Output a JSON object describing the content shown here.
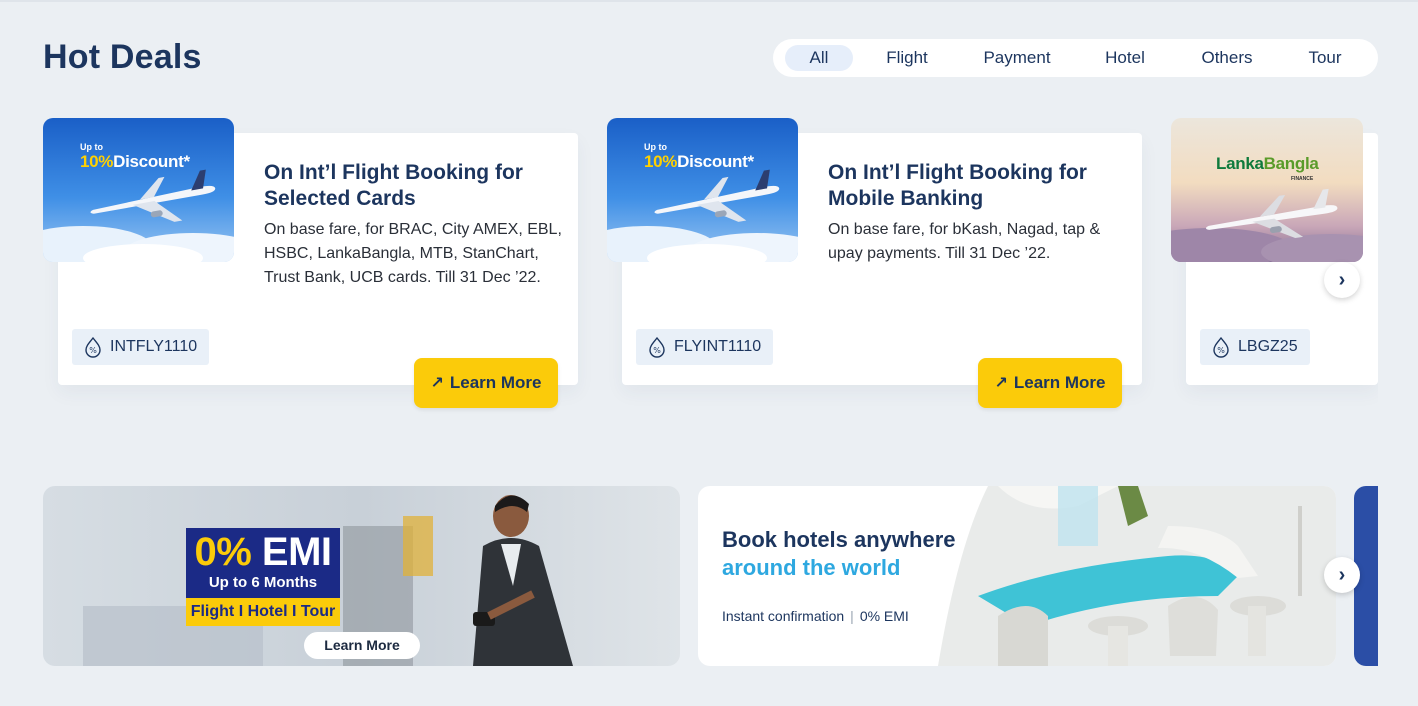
{
  "header": {
    "title": "Hot Deals"
  },
  "filters": {
    "tabs": [
      "All",
      "Flight",
      "Payment",
      "Hotel",
      "Others",
      "Tour"
    ],
    "active": "All"
  },
  "deals": [
    {
      "image_badge_top": "Up to",
      "image_badge_pct": "10%",
      "image_badge_word": "Discount",
      "title": "On Int’l Flight Booking for Selected Cards",
      "description": "On base fare, for BRAC, City AMEX, EBL, HSBC, LankaBangla, MTB, StanChart, Trust Bank, UCB cards. Till 31 Dec ’22.",
      "promo_code": "INTFLY1110",
      "button": "Learn More"
    },
    {
      "image_badge_top": "Up to",
      "image_badge_pct": "10%",
      "image_badge_word": "Discount",
      "title": "On Int’l Flight Booking for Mobile Banking",
      "description": "On base fare, for bKash, Nagad, tap & upay payments. Till 31 Dec ’22.",
      "promo_code": "FLYINT1110",
      "button": "Learn More"
    },
    {
      "image_logo_a": "Lanka",
      "image_logo_b": "Bangla",
      "image_logo_sub": "FINANCE",
      "promo_code": "LBGZ25"
    }
  ],
  "banners": {
    "emi": {
      "big_num": "0",
      "big_pct": "%",
      "big_word": " EMI",
      "sub": "Up to 6 Months",
      "tags": "Flight I Hotel I Tour",
      "button": "Learn More"
    },
    "hotel": {
      "title_line1": "Book hotels anywhere",
      "title_line2": "around the world",
      "feature1": "Instant confirmation",
      "separator": "|",
      "feature2": "0% EMI"
    }
  },
  "icons": {
    "next": "chevron-right-icon",
    "promo": "discount-tag-icon",
    "learn_more": "arrow-up-right-icon"
  },
  "colors": {
    "primary": "#1c355e",
    "accent_yellow": "#fbcb0a",
    "accent_blue": "#2ea8e0",
    "background": "#ebeff3"
  }
}
